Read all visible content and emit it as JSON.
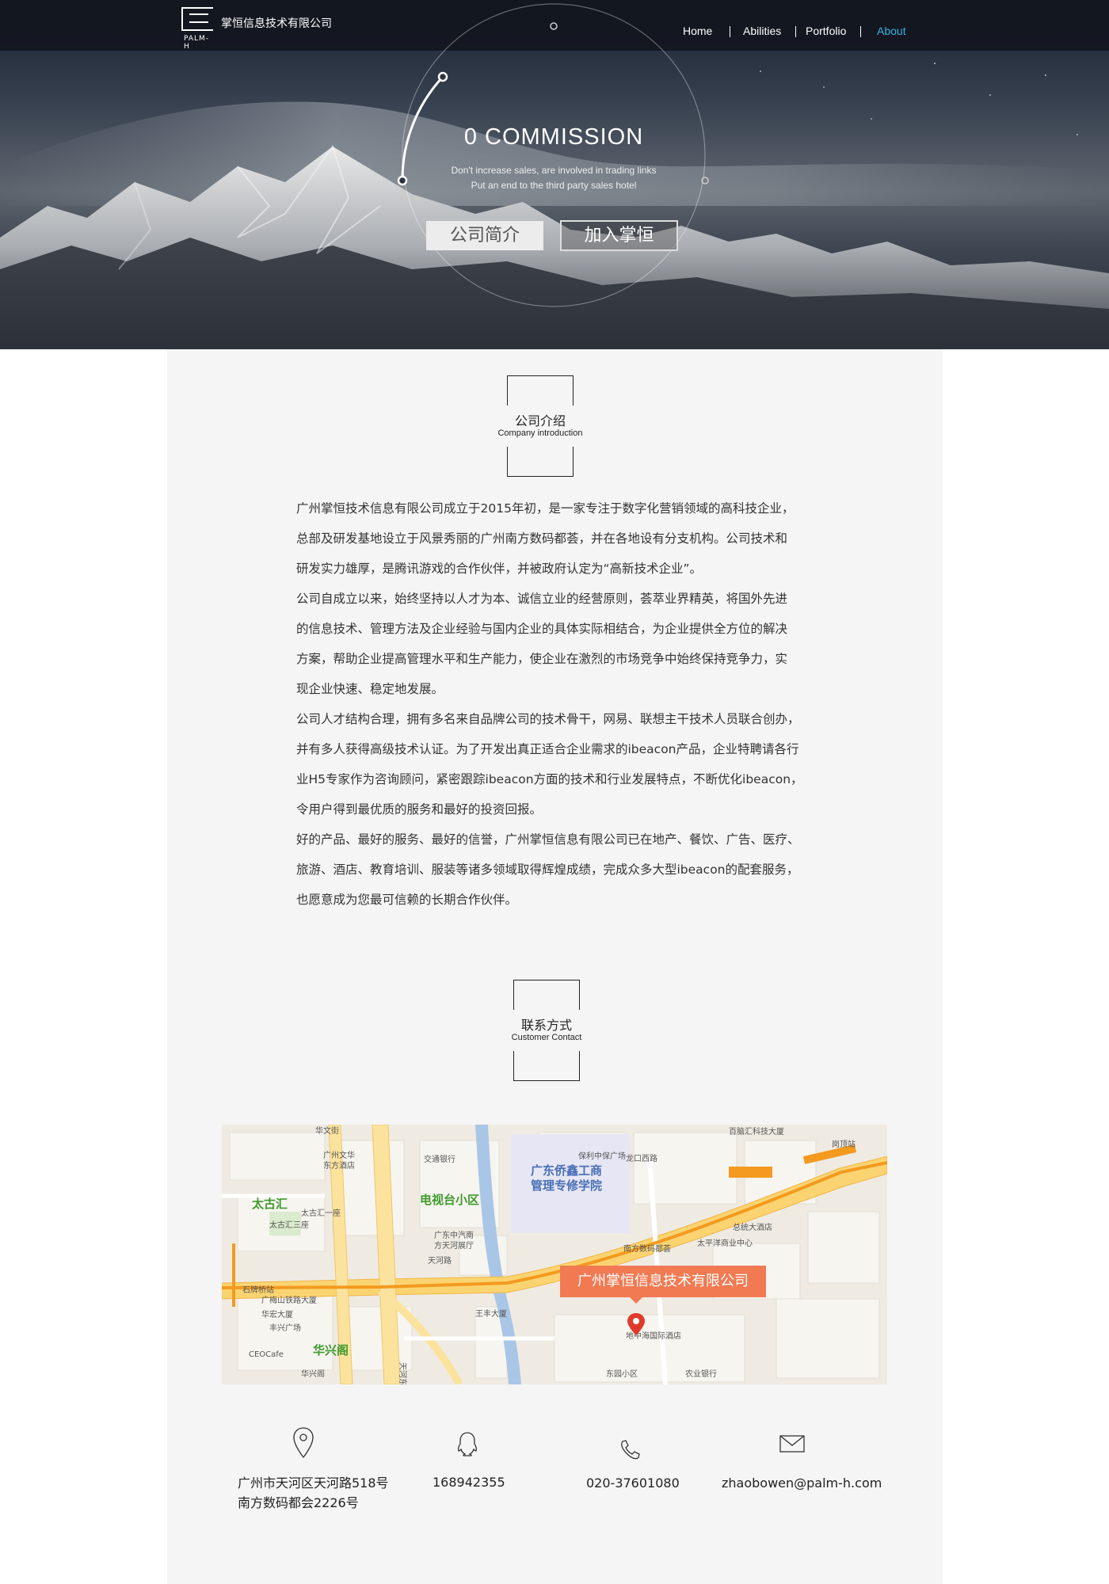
{
  "header": {
    "logo_text": "PALM-H",
    "company_name": "掌恒信息技术有限公司",
    "nav": [
      "Home",
      "Abilities",
      "Portfolio",
      "About"
    ],
    "active_nav": "About",
    "accent": "#36b5e6"
  },
  "hero": {
    "title": "0 COMMISSION",
    "subtitle_line1": "Don't increase sales, are involved in trading links",
    "subtitle_line2": "Put an end to the third party sales hotel",
    "btn_profile": "公司简介",
    "btn_join": "加入掌恒"
  },
  "intro_section": {
    "title_zh": "公司介绍",
    "title_en": "Company introduction",
    "lines": [
      "广州掌恒技术信息有限公司成立于2015年初，是一家专注于数字化营销领域的高科技企业，",
      "总部及研发基地设立于风景秀丽的广州南方数码都荟，并在各地设有分支机构。公司技术和",
      "研发实力雄厚，是腾讯游戏的合作伙伴，并被政府认定为“高新技术企业”。",
      "公司自成立以来，始终坚持以人才为本、诚信立业的经营原则，荟萃业界精英，将国外先进",
      "的信息技术、管理方法及企业经验与国内企业的具体实际相结合，为企业提供全方位的解决",
      "方案，帮助企业提高管理水平和生产能力，使企业在激烈的市场竞争中始终保持竞争力，实",
      "现企业快速、稳定地发展。",
      "公司人才结构合理，拥有多名来自品牌公司的技术骨干，网易、联想主干技术人员联合创办，",
      "并有多人获得高级技术认证。为了开发出真正适合企业需求的ibeacon产品，企业特聘请各行",
      "业H5专家作为咨询顾问，紧密跟踪ibeacon方面的技术和行业发展特点，不断优化ibeacon，",
      "令用户得到最优质的服务和最好的投资回报。",
      "好的产品、最好的服务、最好的信誉，广州掌恒信息有限公司已在地产、餐饮、广告、医疗、",
      "旅游、酒店、教育培训、服装等诸多领域取得辉煌成绩，完成众多大型ibeacon的配套服务，",
      "也愿意成为您最可信赖的长期合作伙伴。"
    ]
  },
  "contact_section": {
    "title_zh": "联系方式",
    "title_en": "Customer Contact"
  },
  "map": {
    "marker_label": "广州掌恒信息技术有限公司",
    "labels": {
      "huahua": "华文街",
      "guangzhou_wenhua": "广州文华",
      "dongfang": "东方酒店",
      "jiaotong": "交通银行",
      "qiaoxin_1": "广东侨鑫工商",
      "qiaoxin_2": "管理专修学院",
      "taigu": "太古汇",
      "taigu_1": "太古汇一座",
      "taigu_3": "太古汇三座",
      "dianshitai": "电视台小区",
      "guangdong_car": "广东中汽南",
      "tianhe_hall": "方天河展厅",
      "shipaiqiao": "石牌桥站",
      "tianhe_rd": "天河路",
      "tianhe_east": "天河东路",
      "huaxingge": "华兴阁",
      "gangshou": "岗顶站",
      "longhu": "龙口西路",
      "baoli": "保利中保广场",
      "nanfang": "南方数码都荟",
      "zhongshan": "总统大酒店",
      "taiping": "太平洋商业中心",
      "yijian": "百脑汇科技大厦",
      "dizhonghai": "地中海国际酒店",
      "dongyuan": "东园小区",
      "nongye": "农业银行",
      "ceocafe": "CEOCafe",
      "guangmei": "广梅山铁路大厦",
      "huahong": "华宏大厦",
      "fengxing": "丰兴广场",
      "wangfeng": "王丰大厦",
      "huaxing_2": "华兴阁"
    }
  },
  "contacts": [
    {
      "icon": "location-pin-icon",
      "text_line1": "广州市天河区天河路518号",
      "text_line2": "南方数码都会2226号"
    },
    {
      "icon": "qq-icon",
      "text_line1": "168942355"
    },
    {
      "icon": "phone-icon",
      "text_line1": "020-37601080"
    },
    {
      "icon": "mail-icon",
      "text_line1": "zhaobowen@palm-h.com"
    }
  ]
}
